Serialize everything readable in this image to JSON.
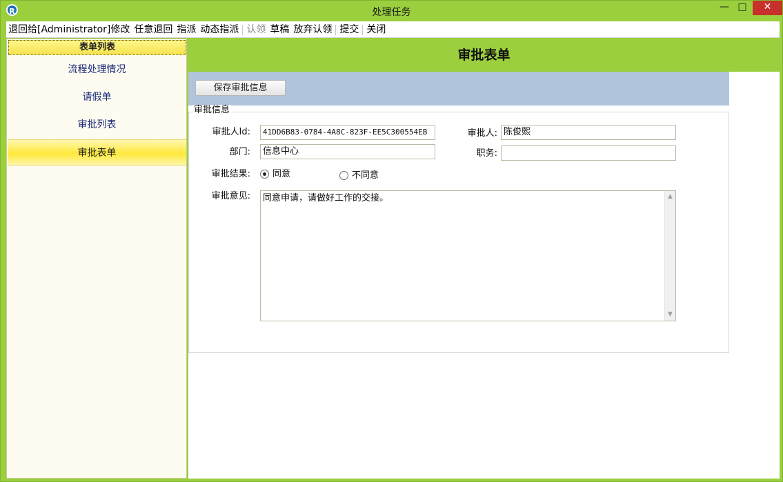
{
  "window": {
    "title": "处理任务",
    "icon_glyph": "R",
    "min_glyph": "—",
    "max_glyph": "□",
    "close_glyph": "✕"
  },
  "menu": {
    "items": [
      {
        "label": "退回给[Administrator]修改",
        "enabled": true
      },
      {
        "label": "任意退回",
        "enabled": true
      },
      {
        "label": "指派",
        "enabled": true
      },
      {
        "label": "动态指派",
        "enabled": true
      },
      {
        "label": "认领",
        "enabled": false
      },
      {
        "label": "草稿",
        "enabled": true
      },
      {
        "label": "放弃认领",
        "enabled": true
      },
      {
        "label": "提交",
        "enabled": true
      },
      {
        "label": "关闭",
        "enabled": true
      }
    ]
  },
  "sidebar": {
    "header": "表单列表",
    "items": [
      {
        "label": "流程处理情况"
      },
      {
        "label": "请假单"
      },
      {
        "label": "审批列表"
      },
      {
        "label": "审批表单"
      }
    ],
    "active_index": 3
  },
  "form": {
    "title": "审批表单",
    "save_label": "保存审批信息",
    "section_legend": "审批信息",
    "approver_id_label": "审批人Id:",
    "approver_id_value": "41DD6B83-0784-4A8C-823F-EE5C300554EB",
    "approver_label": "审批人:",
    "approver_value": "陈俊熙",
    "dept_label": "部门:",
    "dept_value": "信息中心",
    "position_label": "职务:",
    "position_value": "",
    "result_label": "审批结果:",
    "result_agree": "同意",
    "result_disagree": "不同意",
    "result_selected": "同意",
    "opinion_label": "审批意见:",
    "opinion_value": "同意申请，请做好工作的交接。",
    "scroll_up_glyph": "▲",
    "scroll_down_glyph": "▼"
  },
  "colors": {
    "window_green": "#9bcf3e",
    "toolbar_band": "#b0c4dc",
    "sidebar_active": "#ffe83a",
    "close_red": "#c7302b"
  }
}
